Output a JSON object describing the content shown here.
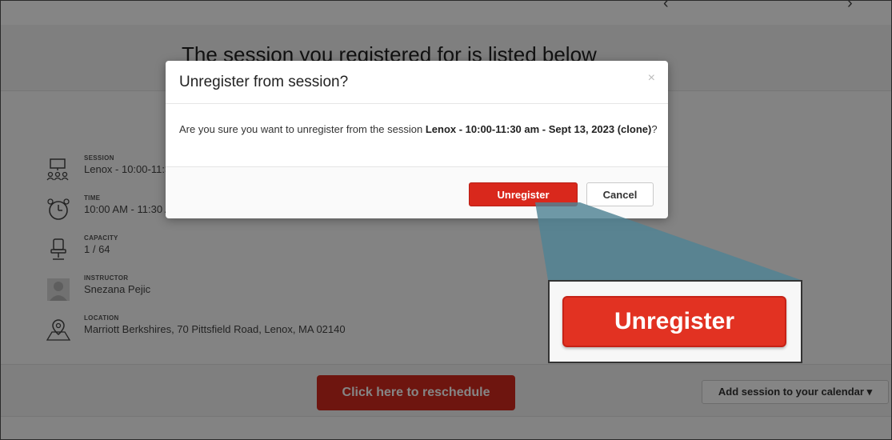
{
  "page": {
    "heading": "The session you registered for is listed below",
    "details": [
      {
        "label": "SESSION",
        "value": "Lenox - 10:00-11:30 am - Sept 13, 2023 (clone)",
        "icon": "session-icon"
      },
      {
        "label": "TIME",
        "value": "10:00 AM - 11:30 AM",
        "icon": "clock-icon"
      },
      {
        "label": "CAPACITY",
        "value": "1 / 64",
        "icon": "chair-icon"
      },
      {
        "label": "INSTRUCTOR",
        "value": "Snezana Pejic",
        "icon": "instructor-avatar"
      },
      {
        "label": "LOCATION",
        "value": "Marriott Berkshires, 70 Pittsfield Road, Lenox, MA 02140",
        "icon": "map-pin-icon"
      }
    ],
    "reschedule_label": "Click here to reschedule",
    "calendar_label": "Add session to your calendar",
    "calendar_caret": "▾"
  },
  "modal": {
    "title": "Unregister from session?",
    "close_glyph": "×",
    "body_prefix": "Are you sure you want to unregister from the session ",
    "session_name": "Lenox - 10:00-11:30 am - Sept 13, 2023 (clone)",
    "body_suffix": "?",
    "unregister_label": "Unregister",
    "cancel_label": "Cancel"
  },
  "callout": {
    "zoom_label": "Unregister",
    "color": "#5b8fa0"
  }
}
